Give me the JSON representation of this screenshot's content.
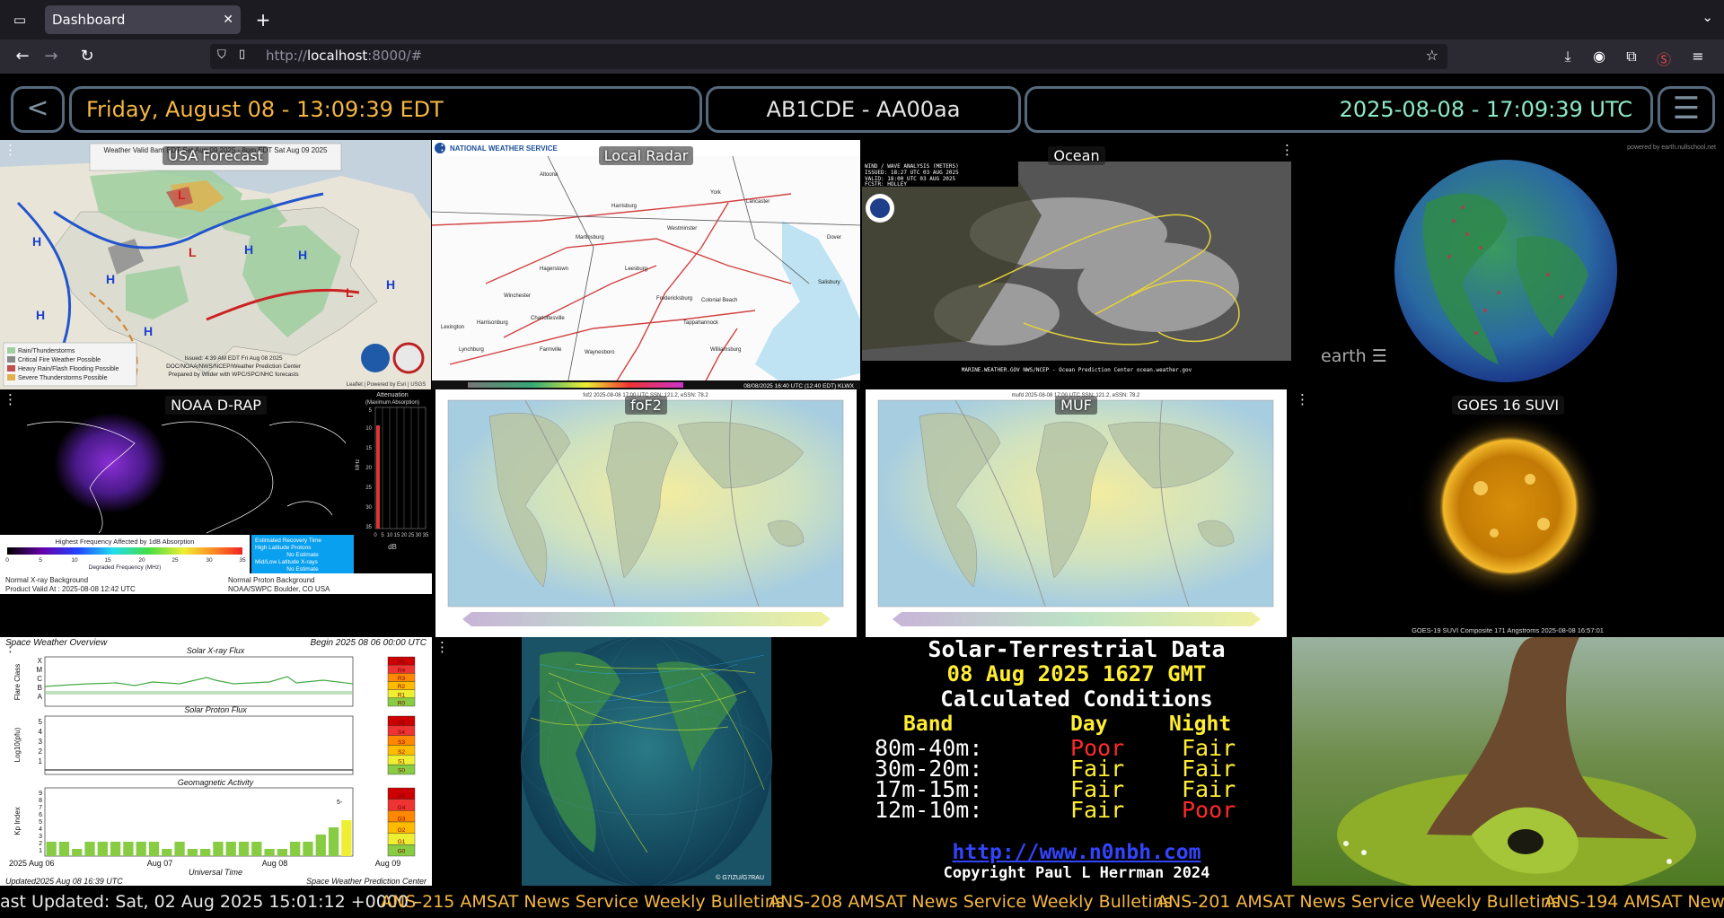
{
  "browser": {
    "tab_title": "Dashboard",
    "url_scheme": "http://",
    "url_host": "localhost",
    "url_path": ":8000/#"
  },
  "header": {
    "back": "<",
    "local_time": "Friday, August 08 - 13:09:39 EDT",
    "callsign": "AB1CDE - AA00aa",
    "utc_time": "2025-08-08 - 17:09:39 UTC",
    "menu": "☰"
  },
  "tiles": {
    "usa_forecast": {
      "title": "USA Forecast",
      "header_text": "Weather Valid 8am EDT Sat Aug 09 2025 - 8pm EDT Sat Aug 09 2025",
      "legend": [
        "Rain/Thunderstorms",
        "Critical Fire Weather Possible",
        "Heavy Rain/Flash Flooding Possible",
        "Severe Thunderstorms Possible"
      ],
      "issued": "Issued: 4:39 AM EDT Fri Aug 08 2025",
      "source": "DOC/NOAA/NWS/NCEP/Weather Prediction Center",
      "prepared": "Prepared by Wilder with WPC/SPC/NHC forecasts",
      "attribution": "Leaflet | Powered by Esri | USGS"
    },
    "local_radar": {
      "title": "Local Radar",
      "nws_label": "NATIONAL WEATHER SERVICE",
      "cities": [
        "Altoona",
        "Harrisburg",
        "York",
        "Lancaster",
        "Westminster",
        "Martinsburg",
        "Hagerstown",
        "Winchester",
        "Leesburg",
        "Charlottesville",
        "Fredericksburg",
        "Salisbury",
        "Dover",
        "Tappahannock",
        "Harrisonburg",
        "Lynchburg",
        "Farmville",
        "Williamsburg",
        "Colonial Beach",
        "Lexington",
        "Waynesboro"
      ],
      "timestamp": "08/08/2025 16:40 UTC (12:40 EDT) KLWX"
    },
    "ocean": {
      "title": "Ocean",
      "info": [
        "WIND / WAVE ANALYSIS (METERS)",
        "ISSUED: 18:27 UTC 03 AUG 2025",
        "VALID: 18:00 UTC 03 AUG 2025",
        "FCSTR: HOLLEY"
      ],
      "footer": "MARINE.WEATHER.GOV  NWS/NCEP - Ocean Prediction Center  ocean.weather.gov"
    },
    "earth": {
      "label": "earth",
      "credit": "powered by earth.nullschool.net"
    },
    "drap": {
      "title": "NOAA D-RAP",
      "attenuation_title": "Attenuation",
      "attenuation_sub": "(Maximum Absorption)",
      "mhz_label": "MHz",
      "db_label": "dB",
      "db_ticks": [
        "0",
        "5",
        "10",
        "15",
        "20",
        "25",
        "30",
        "35"
      ],
      "mhz_ticks": [
        "5",
        "10",
        "15",
        "20",
        "25",
        "30",
        "35"
      ],
      "colorbar_title": "Highest Frequency Affected by 1dB Absorption",
      "colorbar_ticks": [
        "0",
        "5",
        "10",
        "15",
        "20",
        "25",
        "30",
        "35"
      ],
      "colorbar_label": "Degraded Frequency (MHz)",
      "recovery": [
        "Estimated Recovery Time",
        "High Latitude Protons",
        "No Estimate",
        "Mid/Low Latitude X-rays",
        "No Estimate"
      ],
      "xray_bg": "Normal X-ray Background",
      "proton_bg": "Normal Proton Background",
      "product_valid": "Product Valid At : 2025-08-08 12:42 UTC",
      "source": "NOAA/SWPC Boulder, CO USA"
    },
    "fof2": {
      "title": "foF2",
      "subtitle": "fof2 2025-08-08 17:00 UTC  SSN: 121.2, eSSN: 78.2"
    },
    "muf": {
      "title": "MUF",
      "subtitle": "mufd 2025-08-08 17:00 UTC  SSN: 121.2, eSSN: 78.2"
    },
    "goes": {
      "title": "GOES 16 SUVI",
      "caption": "GOES-19 SUVI Composite 171 Angstroms 2025-08-08 16:57:01"
    },
    "swo": {
      "title": "Space Weather Overview",
      "begin": "Begin 2025 08 06 00:00 UTC",
      "xray_title": "Solar X-ray Flux",
      "xray_axis": "Flare Class",
      "xray_classes": [
        "X",
        "M",
        "C",
        "B",
        "A"
      ],
      "xray_scale": [
        "R5",
        "R4",
        "R3",
        "R2",
        "R1",
        "R0"
      ],
      "proton_title": "Solar Proton Flux",
      "proton_axis": "Log10(pfu)",
      "proton_ticks": [
        "5",
        "4",
        "3",
        "2",
        "1"
      ],
      "proton_scale": [
        "S5",
        "S4",
        "S3",
        "S2",
        "S1",
        "S0"
      ],
      "geo_title": "Geomagnetic Activity",
      "geo_axis": "Kp Index",
      "geo_ticks": [
        "9",
        "8",
        "7",
        "6",
        "5",
        "4",
        "3",
        "2",
        "1"
      ],
      "geo_scale": [
        "G5",
        "G4",
        "G3",
        "G2",
        "G1",
        "G0"
      ],
      "geo_peak_label": "5-",
      "dates": [
        "2025 Aug 06",
        "Aug 07",
        "Aug 08",
        "Aug 09"
      ],
      "xaxis_title": "Universal Time",
      "updated": "Updated2025 Aug 08 16:39 UTC",
      "source": "Space Weather Prediction Center",
      "kp_values": [
        2,
        2,
        1,
        2,
        2,
        2,
        2,
        2,
        2,
        1,
        2,
        1,
        1,
        2,
        2,
        2,
        2,
        1,
        1,
        2,
        2,
        3,
        4,
        5
      ]
    },
    "grayline": {
      "credit": "© G7IZU/G7RAU"
    },
    "solar": {
      "title": "Solar-Terrestrial Data",
      "date": "08 Aug 2025 1627 GMT",
      "subtitle": "Calculated Conditions",
      "col_band": "Band",
      "col_day": "Day",
      "col_night": "Night",
      "rows": [
        {
          "band": "80m-40m:",
          "day": "Poor",
          "night": "Fair"
        },
        {
          "band": "30m-20m:",
          "day": "Fair",
          "night": "Fair"
        },
        {
          "band": "17m-15m:",
          "day": "Fair",
          "night": "Fair"
        },
        {
          "band": "12m-10m:",
          "day": "Fair",
          "night": "Poor"
        }
      ],
      "url": "http://www.n0nbh.com",
      "copyright": "Copyright Paul L Herrman 2024"
    }
  },
  "ticker": {
    "updated": "ast Updated: Sat, 02 Aug 2025 15:01:12 +0000 -",
    "items": [
      "ANS-215 AMSAT News Service Weekly Bulletins",
      "ANS-208 AMSAT News Service Weekly Bulletins",
      "ANS-201 AMSAT News Service Weekly Bulletins",
      "ANS-194 AMSAT News"
    ]
  },
  "colors": {
    "accent_amber": "#f5b742",
    "accent_teal": "#8ee9c6",
    "header_border": "#566a7e",
    "solar_poor": "#ff2a2a",
    "solar_fair": "#ffee33"
  }
}
